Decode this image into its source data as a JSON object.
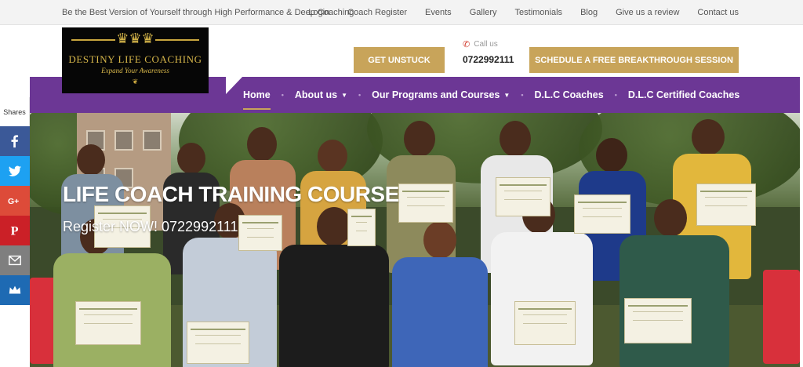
{
  "topbar": {
    "tagline": "Be the Best Version of Yourself through High Performance & Deep Coaching",
    "links": [
      "Login",
      "Coach Register",
      "Events",
      "Gallery",
      "Testimonials",
      "Blog",
      "Give us a review",
      "Contact us"
    ]
  },
  "logo": {
    "title": "DESTINY LIFE COACHING",
    "subtitle": "Expand Your Awareness"
  },
  "header": {
    "get_unstuck": "GET UNSTUCK",
    "call_label": "Call us",
    "call_number": "0722992111",
    "schedule": "SCHEDULE A FREE BREAKTHROUGH SESSION"
  },
  "nav": {
    "items": [
      {
        "label": "Home",
        "active": true
      },
      {
        "label": "About us",
        "dropdown": true
      },
      {
        "label": "Our Programs and Courses",
        "dropdown": true
      },
      {
        "label": "D.L.C Coaches"
      },
      {
        "label": "D.L.C Certified Coaches"
      }
    ]
  },
  "hero": {
    "title": "LIFE COACH TRAINING COURSE",
    "subtitle": "Register NOW! 0722992111"
  },
  "share": {
    "label": "Shares",
    "buttons": [
      "facebook-icon",
      "twitter-icon",
      "google-plus-icon",
      "pinterest-icon",
      "email-icon",
      "sumome-icon"
    ]
  },
  "colors": {
    "nav_purple": "#6c3795",
    "gold": "#c8a45a",
    "logo_bg": "#060606",
    "facebook": "#3b5998",
    "twitter": "#1da1f2",
    "google_plus": "#dd4b39",
    "pinterest": "#cb2027",
    "email": "#7f7f7f",
    "sumome": "#1e6ab3"
  }
}
